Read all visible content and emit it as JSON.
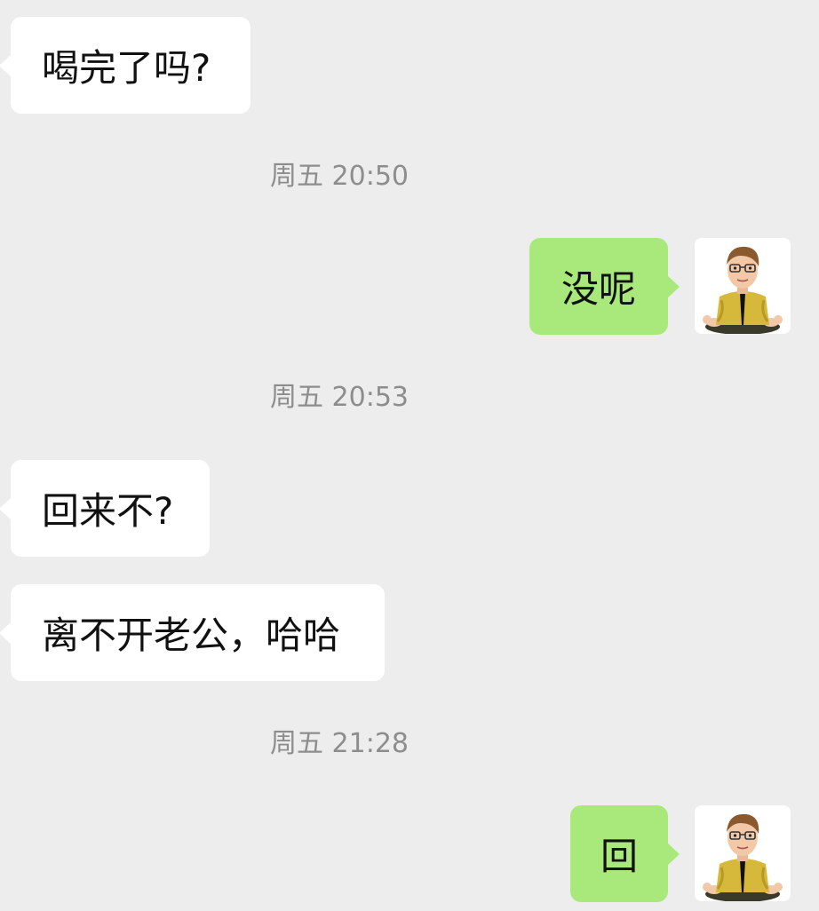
{
  "messages": [
    {
      "direction": "in",
      "text": "喝完了吗?"
    },
    {
      "timestamp": "周五 20:50"
    },
    {
      "direction": "out",
      "text": "没呢"
    },
    {
      "timestamp": "周五 20:53"
    },
    {
      "direction": "in",
      "text": "回来不?"
    },
    {
      "direction": "in",
      "text": "离不开老公，哈哈"
    },
    {
      "timestamp": "周五 21:28"
    },
    {
      "direction": "out",
      "text": "回"
    }
  ],
  "colors": {
    "background": "#ededed",
    "incoming_bubble": "#ffffff",
    "outgoing_bubble": "#a9e97b",
    "timestamp_text": "#8d8d8d"
  },
  "icons": {
    "avatar": "cartoon-man-meditating-avatar"
  }
}
